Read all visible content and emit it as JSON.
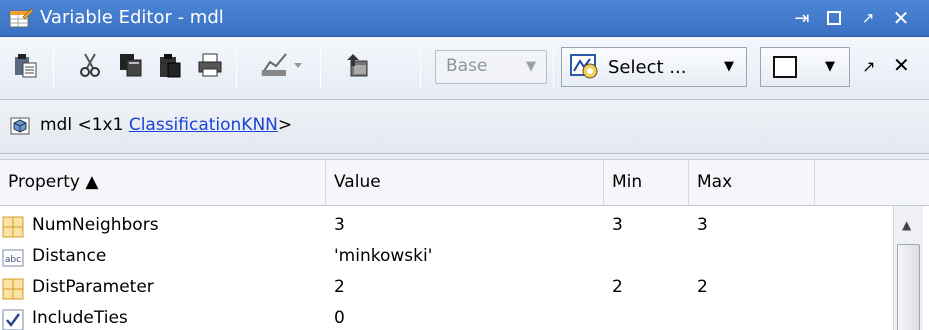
{
  "window": {
    "title": "Variable Editor - mdl"
  },
  "toolbar": {
    "workspace_value": "Base",
    "select_label": "Select ..."
  },
  "variable": {
    "prefix": "mdl <1x1 ",
    "class_link": "ClassificationKNN",
    "suffix": ">"
  },
  "table": {
    "headers": {
      "property": "Property ▲",
      "value": "Value",
      "min": "Min",
      "max": "Max"
    },
    "rows": [
      {
        "icon": "grid-icon",
        "property": "NumNeighbors",
        "value": "3",
        "min": "3",
        "max": "3"
      },
      {
        "icon": "abc-text-icon",
        "property": "Distance",
        "value": "'minkowski'",
        "min": "",
        "max": ""
      },
      {
        "icon": "grid-icon",
        "property": "DistParameter",
        "value": "2",
        "min": "2",
        "max": "2"
      },
      {
        "icon": "checkbox-icon",
        "property": "IncludeTies",
        "value": "0",
        "min": "",
        "max": ""
      }
    ]
  },
  "colors": {
    "titlebar": "#3f78c9",
    "link": "#1a44d6",
    "grid_icon": "#e2a32a"
  }
}
